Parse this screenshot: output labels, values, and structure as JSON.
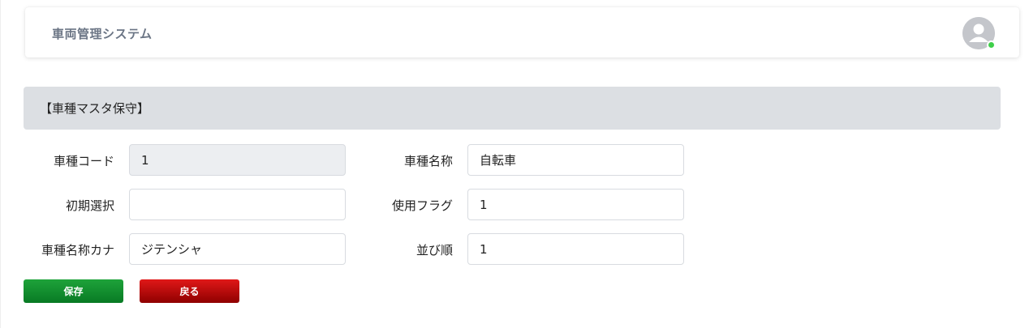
{
  "header": {
    "app_title": "車両管理システム",
    "avatar_icon": "user-avatar-icon",
    "status_color": "#3fcf4a"
  },
  "section": {
    "title": "【車種マスタ保守】"
  },
  "form": {
    "vehicle_type_code": {
      "label": "車種コード",
      "value": "1"
    },
    "initial_selection": {
      "label": "初期選択",
      "value": ""
    },
    "vehicle_type_name_kana": {
      "label": "車種名称カナ",
      "value": "ジテンシャ"
    },
    "vehicle_type_name": {
      "label": "車種名称",
      "value": "自転車"
    },
    "usage_flag": {
      "label": "使用フラグ",
      "value": "1"
    },
    "sort_order": {
      "label": "並び順",
      "value": "1"
    }
  },
  "buttons": {
    "save_label": "保存",
    "back_label": "戻る",
    "save_color": "#0f8a2c",
    "back_color": "#b30a0a"
  }
}
